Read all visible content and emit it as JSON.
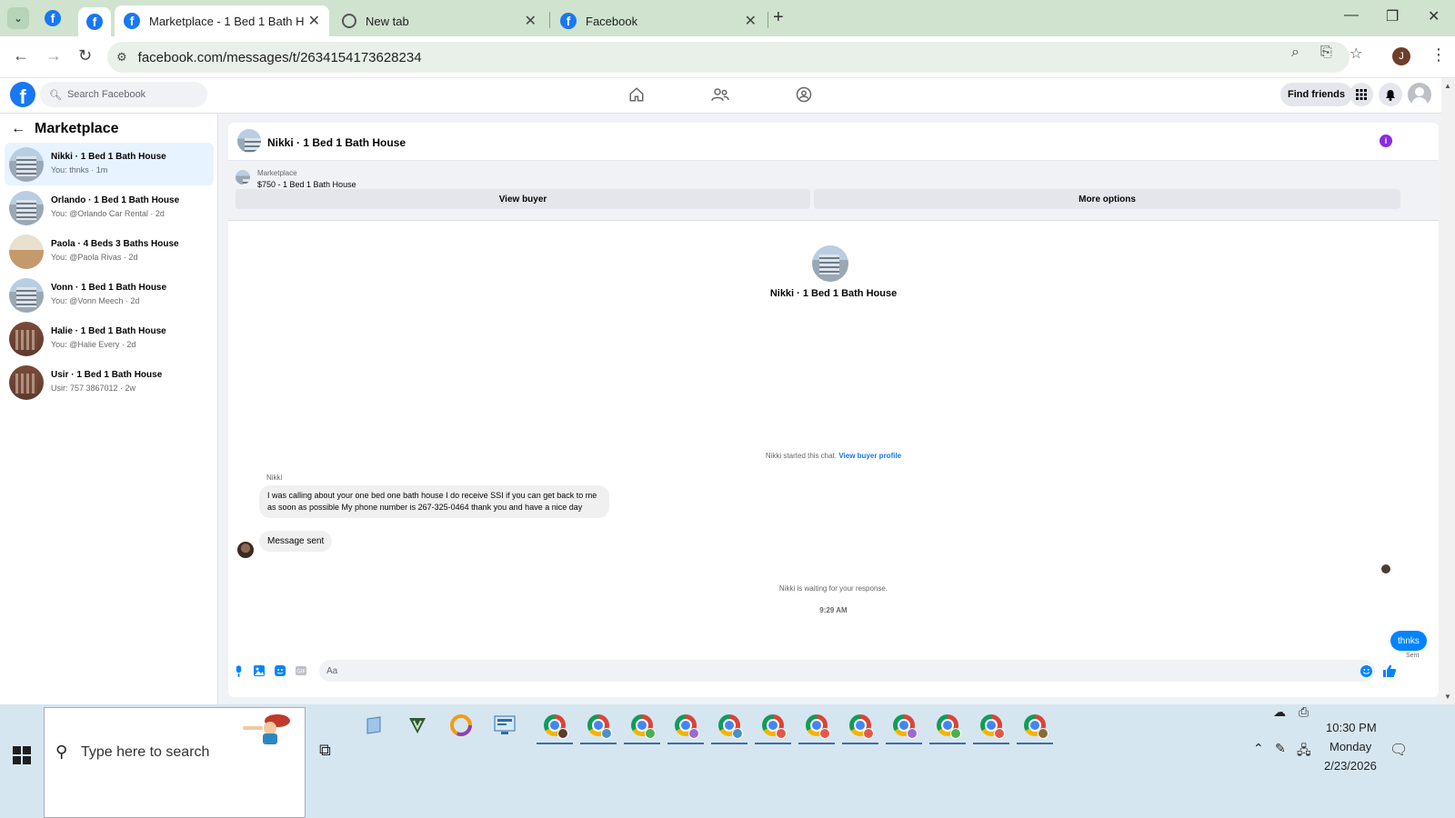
{
  "browser": {
    "tabs": [
      {
        "title": "Marketplace - 1 Bed 1 Bath House",
        "active": true
      },
      {
        "title": "New tab",
        "active": false
      },
      {
        "title": "Facebook",
        "active": false
      }
    ],
    "url": "facebook.com/messages/t/2634154173628234",
    "profile_initial": "J"
  },
  "fb": {
    "search_placeholder": "Search Facebook",
    "find_friends": "Find friends"
  },
  "sidebar": {
    "title": "Marketplace",
    "conversations": [
      {
        "title": "Nikki · 1 Bed 1 Bath House",
        "subtitle": "You: thnks · 1m",
        "selected": true,
        "thumb": "building"
      },
      {
        "title": "Orlando · 1 Bed 1 Bath House",
        "subtitle": "You: @Orlando Car Rental · 2d",
        "selected": false,
        "thumb": "building"
      },
      {
        "title": "Paola · 4 Beds 3 Baths House",
        "subtitle": "You: @Paola Rivas · 2d",
        "selected": false,
        "thumb": "sand"
      },
      {
        "title": "Vonn · 1 Bed 1 Bath House",
        "subtitle": "You: @Vonn Meech · 2d",
        "selected": false,
        "thumb": "building"
      },
      {
        "title": "Halie · 1 Bed 1 Bath House",
        "subtitle": "You: @Halie Every · 2d",
        "selected": false,
        "thumb": "brick"
      },
      {
        "title": "Usir · 1 Bed 1 Bath House",
        "subtitle": "Usir: 757 3867012 · 2w",
        "selected": false,
        "thumb": "brick"
      }
    ]
  },
  "chat": {
    "title": "Nikki · 1 Bed 1 Bath House",
    "marketplace_label": "Marketplace",
    "listing": "$750 - 1 Bed 1 Bath House",
    "view_buyer": "View buyer",
    "more_options": "More options",
    "center_name": "Nikki · 1 Bed 1 Bath House",
    "started_text": "Nikki started this chat.",
    "view_buyer_profile": "View buyer profile",
    "sender_name": "Nikki",
    "incoming_message": "I was calling about your one bed one bath house I do receive SSI if you can get back to me as soon as possible My phone number is 267-325-0464 thank you and have a nice day",
    "message_sent": "Message sent",
    "waiting_text": "Nikki is waiting for your response.",
    "time": "9:29 AM",
    "outgoing_message": "thnks",
    "sent_status": "Sent",
    "composer_placeholder": "Aa"
  },
  "taskbar": {
    "search_placeholder": "Type here to search",
    "time": "10:30 PM",
    "day": "Monday",
    "date": "2/23/2026",
    "chrome_profile_colors": [
      "#5b3a2e",
      "#4a90c4",
      "#4caf50",
      "#9c6ad4",
      "#4a90c4",
      "#e05a4a",
      "#e05a4a",
      "#e05a4a",
      "#9c6ad4",
      "#4caf50",
      "#e05a4a",
      "#8a6a3a"
    ]
  },
  "colors": {
    "fb_blue": "#1877f2",
    "messenger_blue": "#0084ff",
    "tabbar_bg": "#cfe3cf",
    "taskbar_bg": "#d6e6f0"
  }
}
